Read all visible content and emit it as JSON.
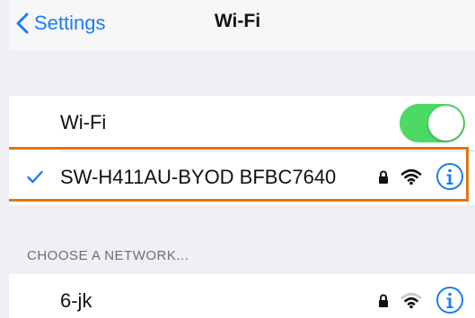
{
  "nav": {
    "back_label": "Settings",
    "title": "Wi-Fi"
  },
  "wifi_toggle": {
    "label": "Wi-Fi",
    "on": true
  },
  "current_network": {
    "name": "SW-H411AU-BYOD BFBC7640",
    "connected": true,
    "secured": true
  },
  "section_header": "CHOOSE A NETWORK...",
  "networks": [
    {
      "name": "6-jk",
      "secured": true
    }
  ],
  "colors": {
    "accent": "#1a7cf5",
    "toggle_on": "#4cd964",
    "highlight": "#e07518",
    "background": "#efeff4"
  }
}
